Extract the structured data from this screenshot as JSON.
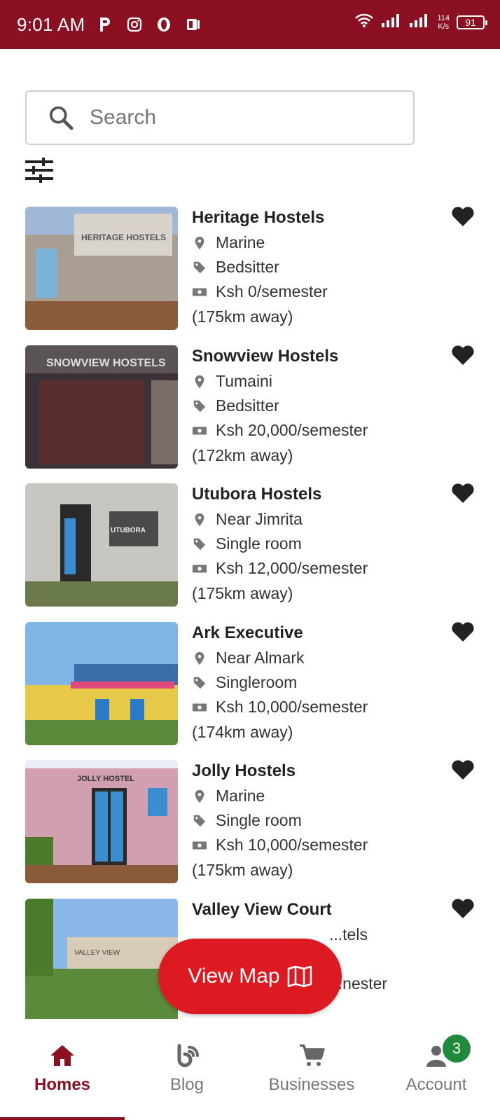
{
  "status_bar": {
    "time": "9:01 AM",
    "speed_top": "114",
    "speed_bottom": "K/s",
    "battery": "91"
  },
  "search": {
    "placeholder": "Search"
  },
  "listings": [
    {
      "name": "Heritage Hostels",
      "location": "Marine",
      "type": "Bedsitter",
      "price": "Ksh 0/semester",
      "distance": "(175km away)"
    },
    {
      "name": "Snowview Hostels",
      "location": "Tumaini",
      "type": "Bedsitter",
      "price": "Ksh 20,000/semester",
      "distance": "(172km away)"
    },
    {
      "name": "Utubora Hostels",
      "location": "Near Jimrita",
      "type": "Single room",
      "price": "Ksh 12,000/semester",
      "distance": "(175km away)"
    },
    {
      "name": "Ark Executive",
      "location": "Near Almark",
      "type": "Singleroom",
      "price": "Ksh 10,000/semester",
      "distance": "(174km away)"
    },
    {
      "name": "Jolly Hostels",
      "location": "Marine",
      "type": "Single room",
      "price": "Ksh 10,000/semester",
      "distance": "(175km away)"
    },
    {
      "name": "Valley View Court",
      "location": "...tels",
      "type": "",
      "price": "...nester",
      "distance": ""
    }
  ],
  "fab": {
    "label": "View Map"
  },
  "bottom_nav": [
    {
      "label": "Homes",
      "icon": "home-icon",
      "active": true
    },
    {
      "label": "Blog",
      "icon": "blog-icon",
      "active": false
    },
    {
      "label": "Businesses",
      "icon": "cart-icon",
      "active": false
    },
    {
      "label": "Account",
      "icon": "account-icon",
      "active": false,
      "badge": "3"
    }
  ],
  "colors": {
    "brand": "#8a1022",
    "fab": "#dd1a22",
    "badge": "#1e8a3a"
  }
}
